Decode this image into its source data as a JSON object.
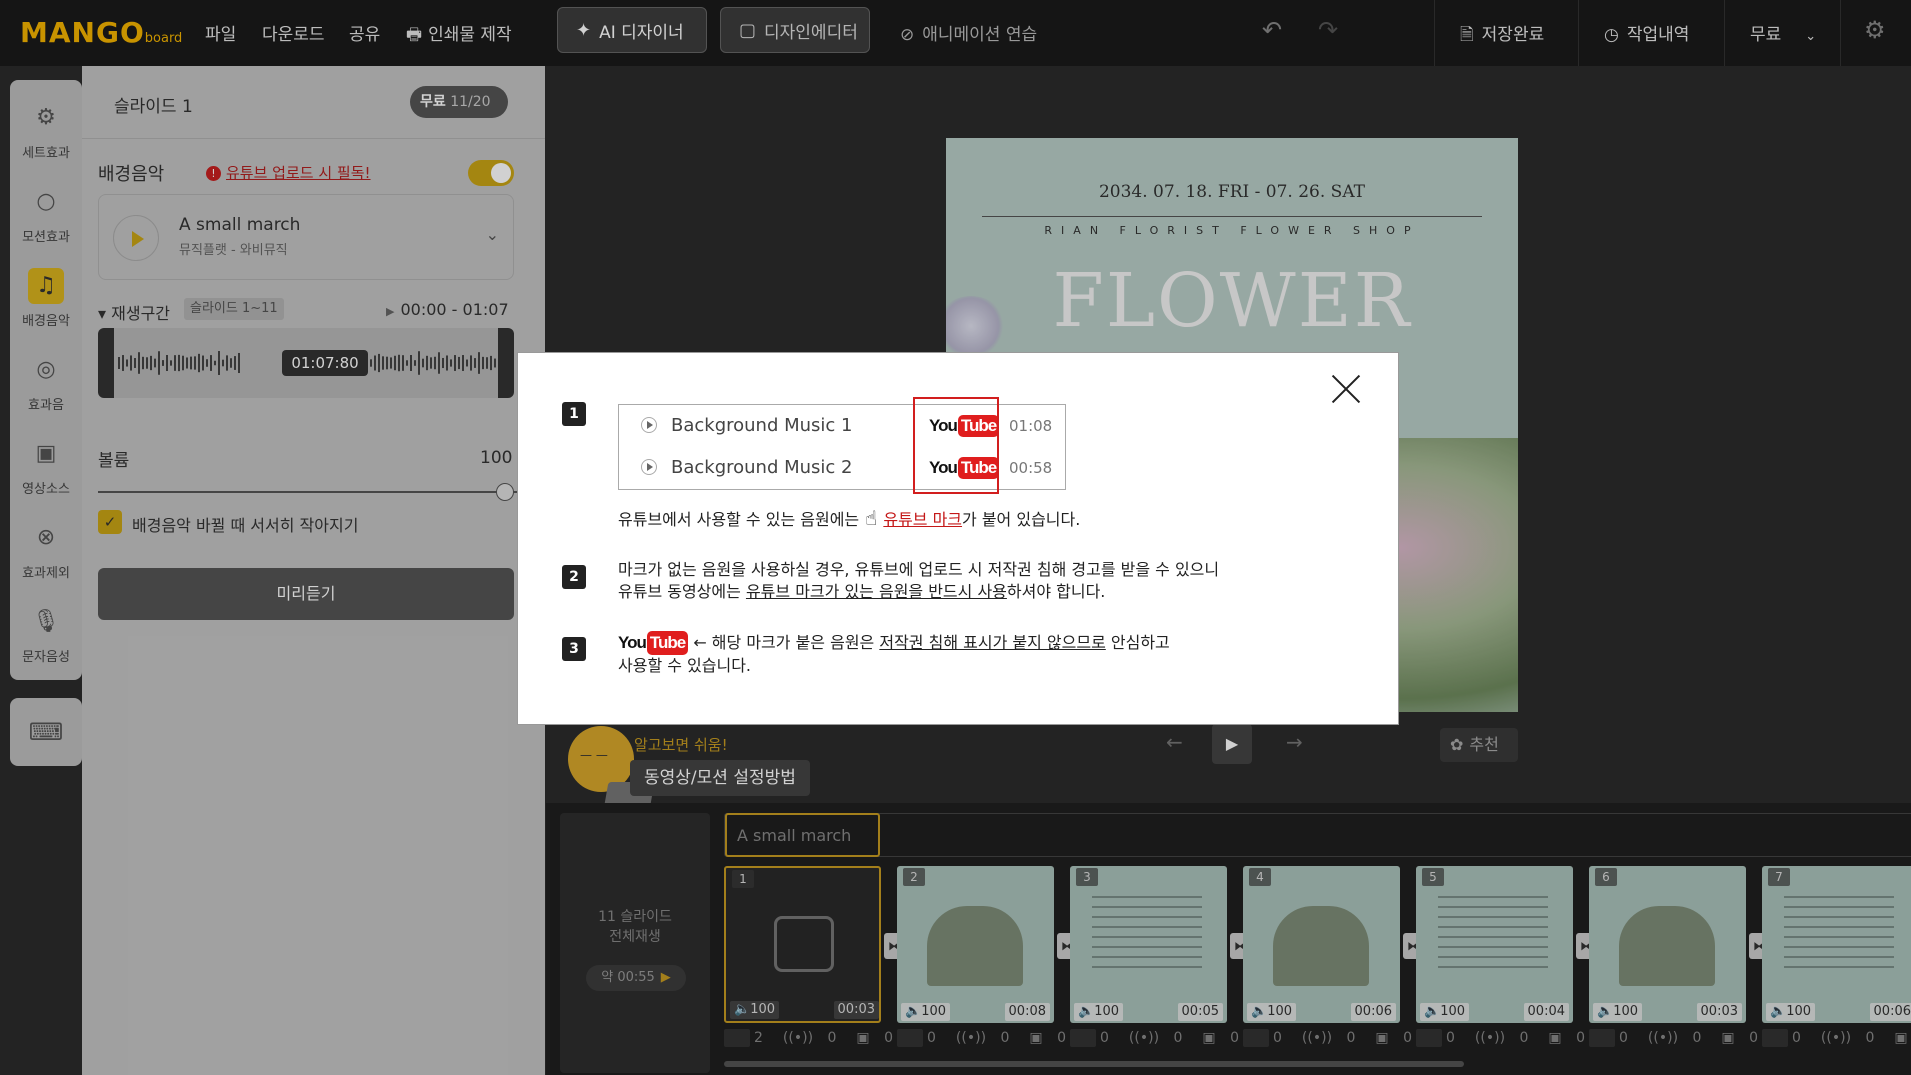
{
  "topbar": {
    "logo_main": "MANGO",
    "logo_sub": "board",
    "menu": [
      "파일",
      "다운로드",
      "공유",
      "인쇄물 제작"
    ],
    "ai_designer": "AI 디자이너",
    "design_editor": "디자인에디터",
    "animation_practice": "애니메이션 연습",
    "save_status": "저장완료",
    "history": "작업내역",
    "plan": "무료",
    "brand_color": "#f5b400"
  },
  "rail": {
    "items": [
      {
        "label": "세트효과",
        "icon": "gear-icon"
      },
      {
        "label": "모션효과",
        "icon": "circle-icon"
      },
      {
        "label": "배경음악",
        "icon": "music-note-icon"
      },
      {
        "label": "효과음",
        "icon": "target-icon"
      },
      {
        "label": "영상소스",
        "icon": "film-icon"
      },
      {
        "label": "효과제외",
        "icon": "cancel-icon"
      },
      {
        "label": "문자음성",
        "icon": "microphone-icon"
      }
    ],
    "active": "배경음악"
  },
  "panel": {
    "slide_title": "슬라이드 1",
    "free_label": "무료",
    "free_count": "11/20",
    "bgm_label": "배경음악",
    "youtube_warning": "유튜브 업로드 시 필독!",
    "music_name": "A small march",
    "music_artist": "뮤직플랫 - 와비뮤직",
    "range_label": "재생구간",
    "range_chip": "슬라이드 1~11",
    "range_time": "00:00 - 01:07",
    "wave_time": "01:07:80",
    "volume_label": "볼륨",
    "volume_value": "100",
    "volume_level": 1.0,
    "fade_label": "배경음악 바뀔 때 서서히 작아지기",
    "preview_button": "미리듣기"
  },
  "canvas": {
    "date": "2034. 07. 18. FRI - 07. 26. SAT",
    "shop": "RIAN FLORIST FLOWER SHOP",
    "big_title": "FLOWER"
  },
  "controls": {
    "recommend": "추천",
    "tip_note": "알고보면 쉬움!",
    "tip_button": "동영상/모션 설정방법"
  },
  "timeline": {
    "slide_count": "11 슬라이드",
    "play_all": "전체재생",
    "approx": "약",
    "approx_time": "00:55",
    "track_label": "A small march",
    "slides": [
      {
        "num": "1",
        "vol": "100",
        "dur": "00:03",
        "stat_a": "2",
        "stat_b": "0",
        "stat_c": "0"
      },
      {
        "num": "2",
        "vol": "100",
        "dur": "00:08",
        "stat_a": "0",
        "stat_b": "0",
        "stat_c": "0"
      },
      {
        "num": "3",
        "vol": "100",
        "dur": "00:05",
        "stat_a": "0",
        "stat_b": "0",
        "stat_c": "0"
      },
      {
        "num": "4",
        "vol": "100",
        "dur": "00:06",
        "stat_a": "0",
        "stat_b": "0",
        "stat_c": "0"
      },
      {
        "num": "5",
        "vol": "100",
        "dur": "00:04",
        "stat_a": "0",
        "stat_b": "0",
        "stat_c": "0"
      },
      {
        "num": "6",
        "vol": "100",
        "dur": "00:03",
        "stat_a": "0",
        "stat_b": "0",
        "stat_c": "0"
      },
      {
        "num": "7",
        "vol": "100",
        "dur": "00:06",
        "stat_a": "0",
        "stat_b": "0",
        "stat_c": "0"
      }
    ]
  },
  "modal": {
    "step1": "1",
    "step2": "2",
    "step3": "3",
    "samples": [
      {
        "name": "Background Music 1",
        "time": "01:08"
      },
      {
        "name": "Background Music 2",
        "time": "00:58"
      }
    ],
    "yt_you": "You",
    "yt_tube": "Tube",
    "line1_a": "유튜브에서 사용할 수 있는 음원에는",
    "line1_link": "유튜브 마크",
    "line1_b": "가 붙어 있습니다.",
    "line2_a": "마크가 없는 음원을 사용하실 경우, 유튜브에 업로드 시 저작권 침해 경고를 받을 수 있으니",
    "line2_b": "유튜브 동영상에는",
    "line2_u": "유튜브 마크가 있는 음원을 반드시 사용",
    "line2_c": "하셔야 합니다.",
    "line3_a": "← 해당 마크가 붙은 음원은",
    "line3_u": "저작권 침해 표시가 붙지 않으므로",
    "line3_b": "안심하고",
    "line3_c": "사용할 수 있습니다."
  }
}
